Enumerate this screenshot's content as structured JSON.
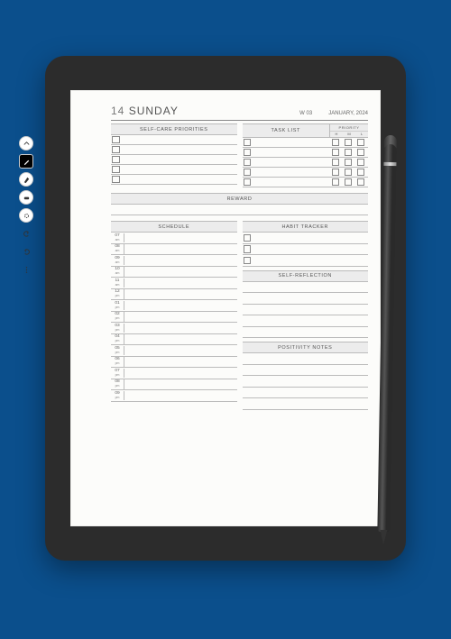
{
  "header": {
    "day_number": "14",
    "day_name": "SUNDAY",
    "week": "W 03",
    "month_year": "JANUARY, 2024"
  },
  "sections": {
    "self_care": "SELF-CARE PRIORITIES",
    "task_list": "TASK LIST",
    "priority": "PRIORITY",
    "priority_h": "H",
    "priority_m": "M",
    "priority_l": "L",
    "reward": "REWARD",
    "schedule": "SCHEDULE",
    "habit_tracker": "HABIT TRACKER",
    "self_reflection": "SELF-REFLECTION",
    "positivity": "POSITIVITY NOTES"
  },
  "schedule": [
    {
      "h": "07",
      "p": "am"
    },
    {
      "h": "08",
      "p": "am"
    },
    {
      "h": "09",
      "p": "am"
    },
    {
      "h": "10",
      "p": "am"
    },
    {
      "h": "11",
      "p": "am"
    },
    {
      "h": "12",
      "p": "pm"
    },
    {
      "h": "01",
      "p": "pm"
    },
    {
      "h": "02",
      "p": "pm"
    },
    {
      "h": "03",
      "p": "pm"
    },
    {
      "h": "04",
      "p": "pm"
    },
    {
      "h": "05",
      "p": "pm"
    },
    {
      "h": "06",
      "p": "pm"
    },
    {
      "h": "07",
      "p": "pm"
    },
    {
      "h": "08",
      "p": "pm"
    },
    {
      "h": "09",
      "p": "pm"
    }
  ],
  "counts": {
    "self_care_rows": 5,
    "task_rows": 5,
    "habit_rows": 3
  }
}
